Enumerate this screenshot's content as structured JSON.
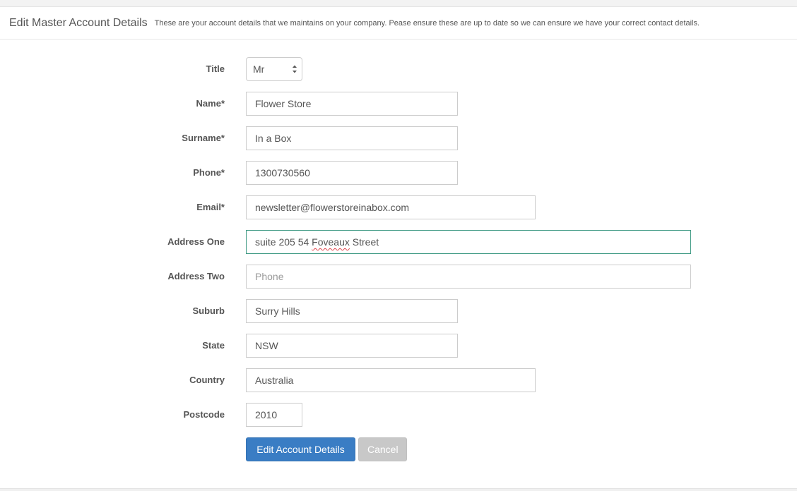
{
  "header": {
    "title": "Edit Master Account Details",
    "subtitle": "These are your account details that we maintains on your company. Pease ensure these are up to date so we can ensure we have your correct contact details."
  },
  "form": {
    "title": {
      "label": "Title",
      "value": "Mr"
    },
    "name": {
      "label": "Name*",
      "value": "Flower Store"
    },
    "surname": {
      "label": "Surname*",
      "value": "In a Box"
    },
    "phone": {
      "label": "Phone*",
      "value": "1300730560"
    },
    "email": {
      "label": "Email*",
      "value": "newsletter@flowerstoreinabox.com"
    },
    "address_one": {
      "label": "Address One",
      "value_before": "suite 205 54 ",
      "value_misspelled": "Foveaux",
      "value_after": " Street"
    },
    "address_two": {
      "label": "Address Two",
      "value": "",
      "placeholder": "Phone"
    },
    "suburb": {
      "label": "Suburb",
      "value": "Surry Hills"
    },
    "state": {
      "label": "State",
      "value": "NSW"
    },
    "country": {
      "label": "Country",
      "value": "Australia"
    },
    "postcode": {
      "label": "Postcode",
      "value": "2010"
    }
  },
  "actions": {
    "submit_label": "Edit Account Details",
    "cancel_label": "Cancel"
  },
  "colors": {
    "primary_button": "#3a7dc4",
    "cancel_button": "#c8c8c8",
    "focus_border": "#3f9a84"
  }
}
